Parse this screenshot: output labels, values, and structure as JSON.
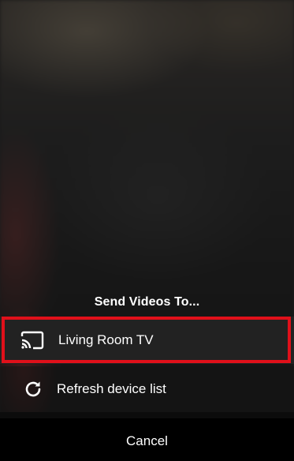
{
  "sheet": {
    "title": "Send Videos To..."
  },
  "devices": [
    {
      "label": "Living Room TV",
      "icon": "cast-icon",
      "highlighted": true,
      "highlight_color": "#e0101a"
    }
  ],
  "actions": {
    "refresh_label": "Refresh device list",
    "refresh_icon": "refresh-icon",
    "cancel_label": "Cancel"
  }
}
